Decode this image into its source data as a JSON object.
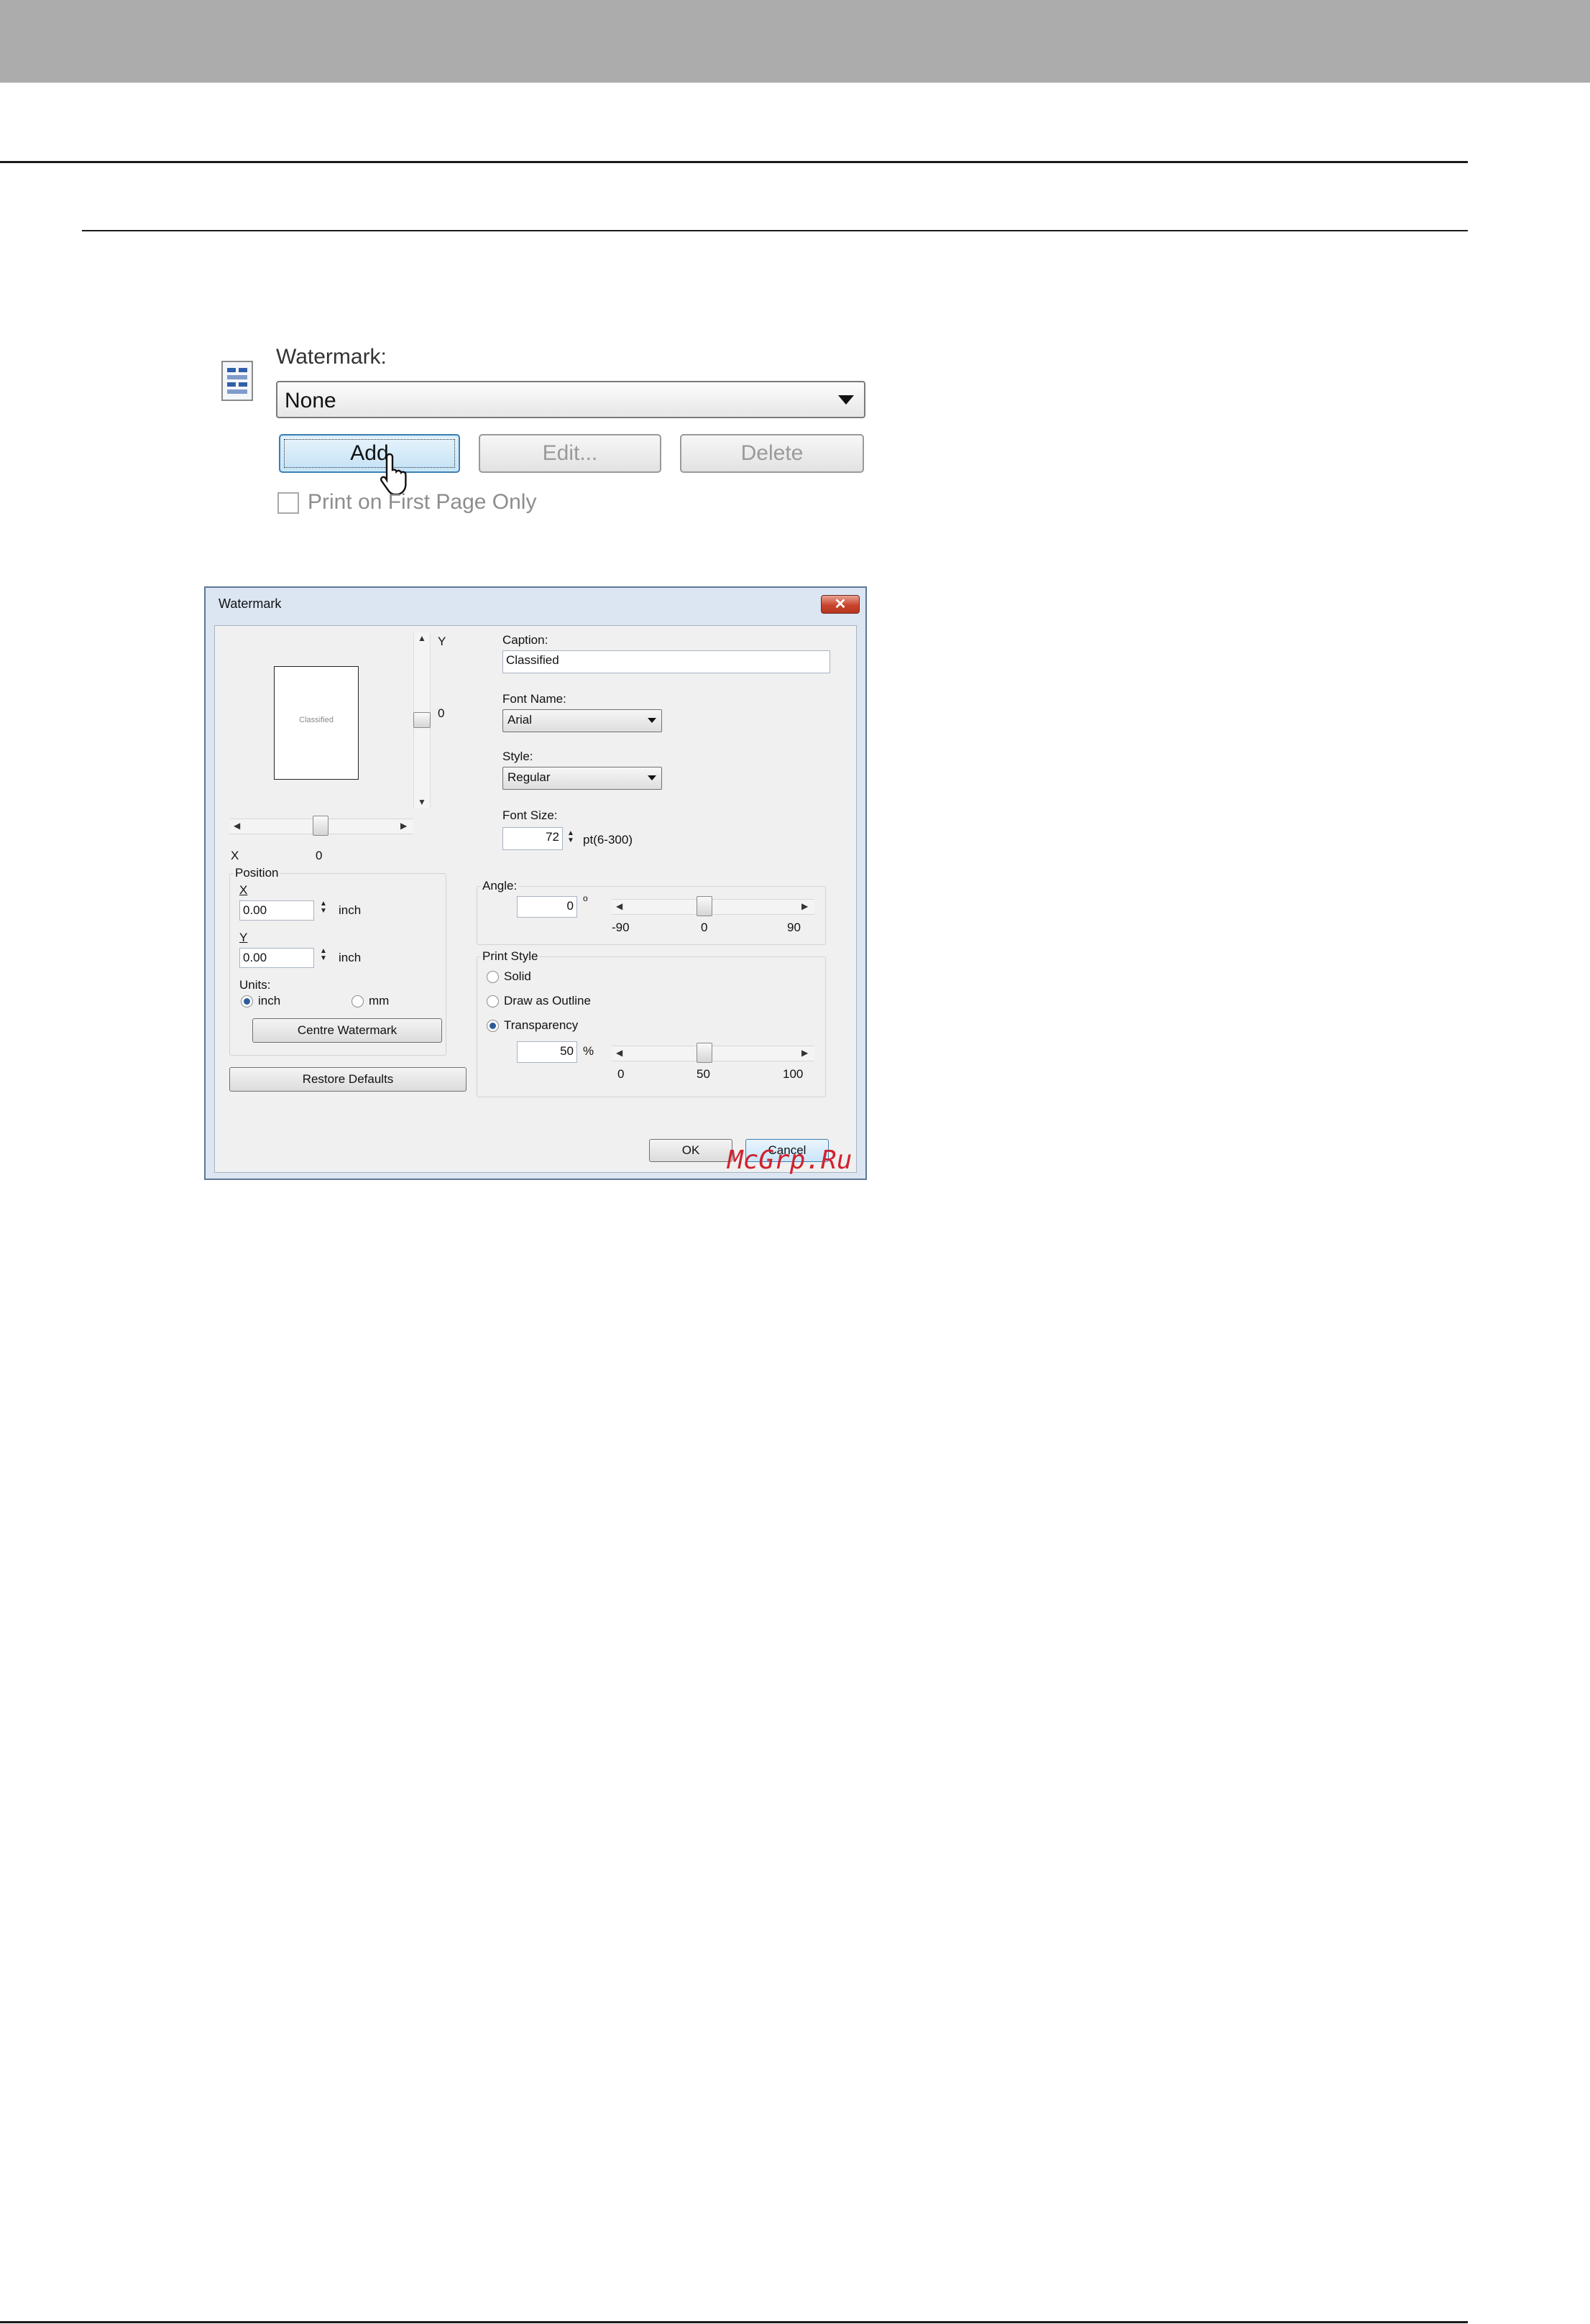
{
  "snippet": {
    "watermark_label": "Watermark:",
    "selected": "None",
    "add_label": "Add",
    "edit_label": "Edit...",
    "delete_label": "Delete",
    "first_page_label": "Print on First Page Only",
    "first_page_checked": false
  },
  "dialog": {
    "title": "Watermark",
    "close_glyph": "✕",
    "preview_text": "Classified",
    "y_axis_label": "Y",
    "y_value": "0",
    "x_axis_label": "X",
    "x_value": "0",
    "position": {
      "group_label": "Position",
      "x_label": "X",
      "x_value": "0.00",
      "x_unit": "inch",
      "y_label": "Y",
      "y_value": "0.00",
      "y_unit": "inch",
      "units_label": "Units:",
      "unit_inch": "inch",
      "unit_mm": "mm",
      "selected_unit": "inch",
      "centre_button": "Centre Watermark"
    },
    "restore_button": "Restore Defaults",
    "caption_label": "Caption:",
    "caption_value": "Classified",
    "font_name_label": "Font Name:",
    "font_name_value": "Arial",
    "style_label": "Style:",
    "style_value": "Regular",
    "font_size_label": "Font Size:",
    "font_size_value": "72",
    "font_size_range": "pt(6-300)",
    "angle": {
      "group_label": "Angle:",
      "value": "0",
      "degree_symbol": "o",
      "min_label": "-90",
      "mid_label": "0",
      "max_label": "90",
      "slider_level": 0
    },
    "print_style": {
      "group_label": "Print Style",
      "solid": "Solid",
      "outline": "Draw as Outline",
      "transparency": "Transparency",
      "selected": "Transparency",
      "transparency_value": "50",
      "percent_symbol": "%",
      "min_label": "0",
      "mid_label": "50",
      "max_label": "100",
      "slider_level": 50
    },
    "ok_button": "OK",
    "cancel_button": "Cancel"
  },
  "watermark_text": "McGrp.Ru",
  "colors": {
    "top_band": "#acacac",
    "dialog_frame": "#dbe6f2",
    "close_button": "#c8442d",
    "add_button": "#c3e2f7",
    "watermark_red": "#d0222f"
  }
}
